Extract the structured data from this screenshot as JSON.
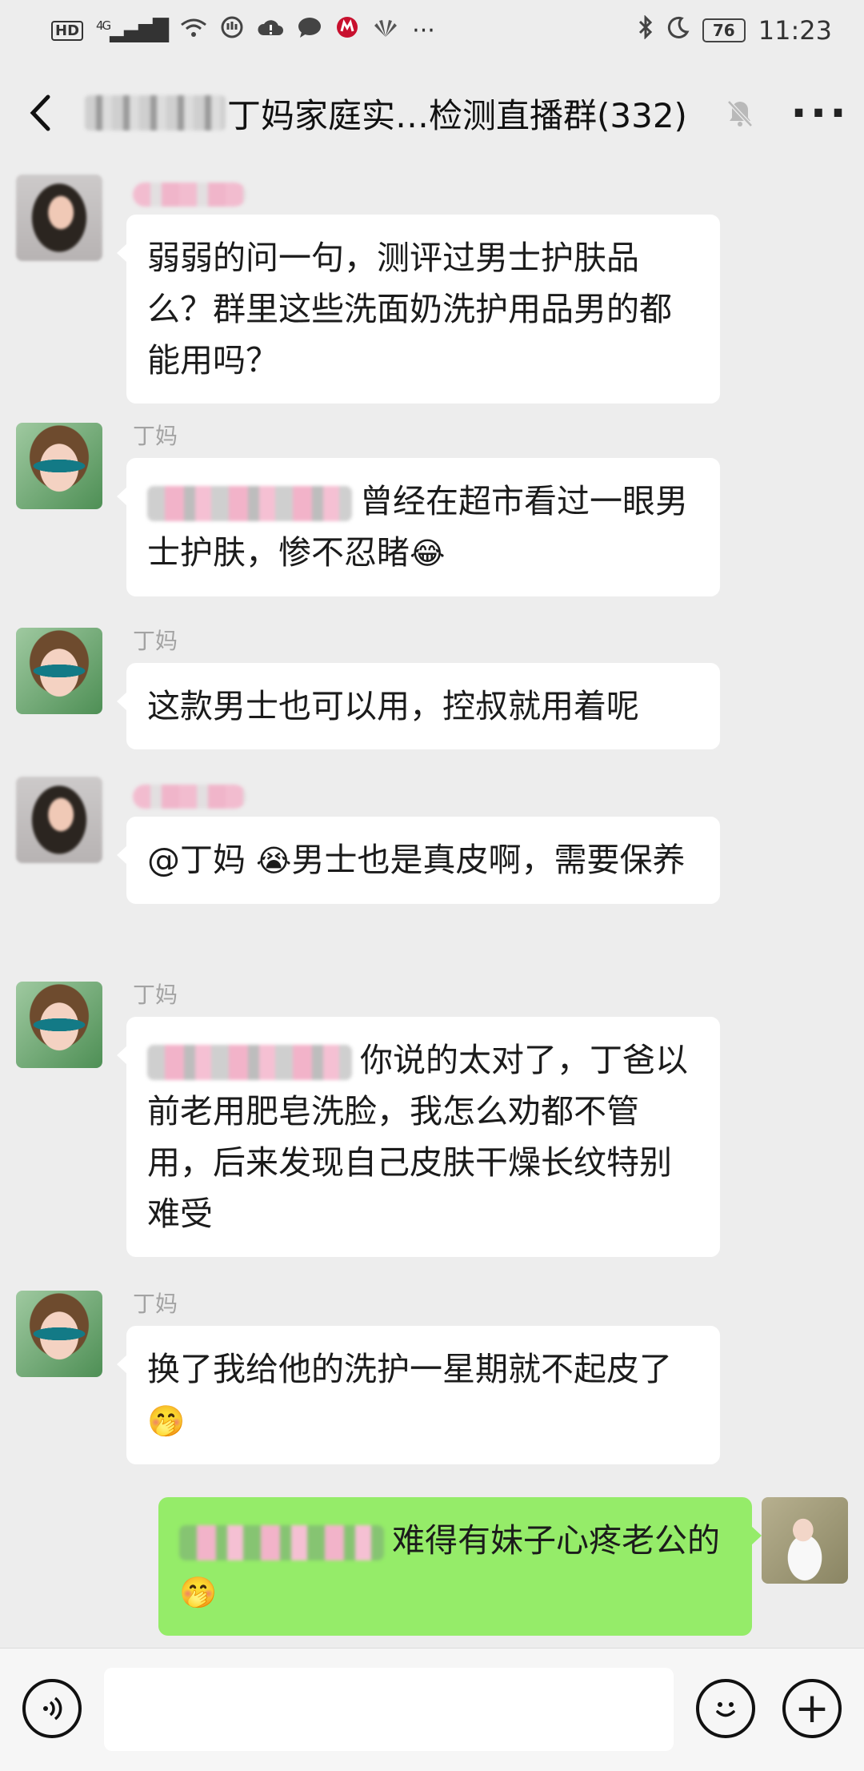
{
  "status_bar": {
    "hd_label": "HD",
    "network_label": "4G",
    "battery_level": "76",
    "time": "11:23",
    "icons": [
      "signal-icon",
      "wifi-icon",
      "gesture-icon",
      "cloud-alert-icon",
      "chat-icon",
      "bank-app-icon",
      "huawei-icon",
      "more-notifications-icon",
      "bluetooth-icon",
      "moon-icon",
      "battery-icon"
    ]
  },
  "header": {
    "title": "丁妈家庭实…检测直播群(332)",
    "back_icon": "chevron-left-icon",
    "mute_icon": "bell-muted-icon",
    "more_label": "···"
  },
  "messages": [
    {
      "sender": "",
      "avatar": "blurred-user-avatar",
      "text": "弱弱的问一句，测评过男士护肤品么？群里这些洗面奶洗护用品男的都能用吗？"
    },
    {
      "sender": "丁妈",
      "avatar": "dingma-avatar",
      "mention_blurred": true,
      "text": "曾经在超市看过一眼男士护肤，惨不忍睹",
      "emoji": "😂"
    },
    {
      "sender": "丁妈",
      "avatar": "dingma-avatar",
      "text": "这款男士也可以用，控叔就用着呢"
    },
    {
      "sender": "",
      "avatar": "blurred-user-avatar",
      "text_prefix": "@丁妈 ",
      "emoji": "😭",
      "text": "男士也是真皮啊，需要保养"
    },
    {
      "sender": "丁妈",
      "avatar": "dingma-avatar",
      "mention_blurred": true,
      "text": "你说的太对了，丁爸以前老用肥皂洗脸，我怎么劝都不管用，后来发现自己皮肤干燥长纹特别难受"
    },
    {
      "sender": "丁妈",
      "avatar": "dingma-avatar",
      "text": "换了我给他的洗护一星期就不起皮了",
      "emoji": "🤭"
    },
    {
      "sender": "self",
      "avatar": "self-avatar",
      "mention_blurred": true,
      "text": "难得有妹子心疼老公的",
      "emoji": "🤭"
    }
  ],
  "input_bar": {
    "voice_icon": "voice-icon",
    "emoji_icon": "smiley-icon",
    "plus_label": "+",
    "input_value": ""
  }
}
